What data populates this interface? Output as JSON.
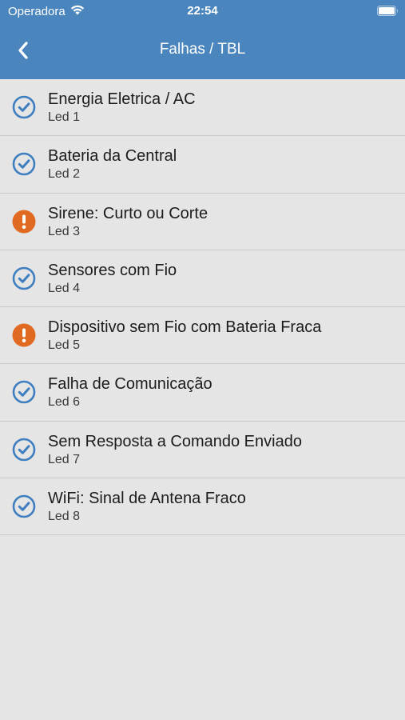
{
  "status_bar": {
    "carrier": "Operadora",
    "time": "22:54"
  },
  "nav": {
    "title": "Falhas / TBL",
    "back_icon": "chevron-left-icon"
  },
  "colors": {
    "header_bg": "#4a86bd",
    "ok": "#3f7fc0",
    "warning": "#e06a21",
    "list_bg": "#e5e5e5"
  },
  "items": [
    {
      "title": "Energia Eletrica / AC",
      "subtitle": "Led 1",
      "status": "ok"
    },
    {
      "title": "Bateria da Central",
      "subtitle": "Led 2",
      "status": "ok"
    },
    {
      "title": "Sirene: Curto ou Corte",
      "subtitle": "Led 3",
      "status": "warning"
    },
    {
      "title": "Sensores com Fio",
      "subtitle": "Led 4",
      "status": "ok"
    },
    {
      "title": "Dispositivo sem Fio com Bateria Fraca",
      "subtitle": "Led 5",
      "status": "warning"
    },
    {
      "title": "Falha de Comunicação",
      "subtitle": "Led 6",
      "status": "ok"
    },
    {
      "title": "Sem Resposta a Comando Enviado",
      "subtitle": "Led 7",
      "status": "ok"
    },
    {
      "title": "WiFi: Sinal de Antena Fraco",
      "subtitle": "Led 8",
      "status": "ok"
    }
  ]
}
